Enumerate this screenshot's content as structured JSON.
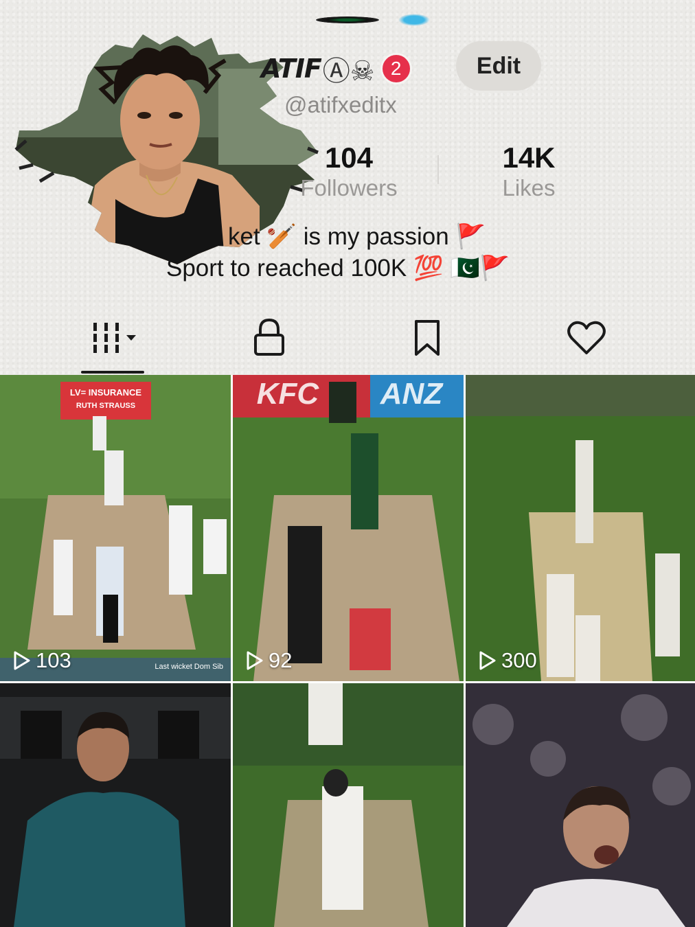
{
  "profile": {
    "display_name": "ATIF",
    "name_decoration": "Ⓐ☠",
    "notification_count": "2",
    "handle": "@atifxeditx",
    "edit_label": "Edit"
  },
  "stats": {
    "followers_value": "104",
    "followers_label": "Followers",
    "likes_value": "14K",
    "likes_label": "Likes"
  },
  "bio": {
    "line1": "ket 🏏 is my passion 🚩",
    "line2": "Sport to reached 100K 💯 🇵🇰🚩"
  },
  "tabs": [
    {
      "icon": "videos-grid-icon",
      "active": true
    },
    {
      "icon": "lock-icon",
      "active": false
    },
    {
      "icon": "bookmark-icon",
      "active": false
    },
    {
      "icon": "heart-icon",
      "active": false
    }
  ],
  "videos": [
    {
      "views": "103",
      "scene": "cricket-test-match-bowler",
      "overlay_text": "LV= INSURANCE",
      "overlay_text2": "RUTH STRAUSS",
      "caption": "Last wicket Dom Sib"
    },
    {
      "views": "92",
      "scene": "cricket-bowler-number-38",
      "overlay_text": "KFC",
      "overlay_text2": "ANZ"
    },
    {
      "views": "300",
      "scene": "cricket-test-match-wide"
    },
    {
      "scene": "man-teal-kurta"
    },
    {
      "scene": "cricket-batsman-white"
    },
    {
      "scene": "footballer-celebration"
    }
  ],
  "colors": {
    "badge": "#e6304b",
    "background": "#ebeae7",
    "pitch_green": "#3f6b2c"
  }
}
